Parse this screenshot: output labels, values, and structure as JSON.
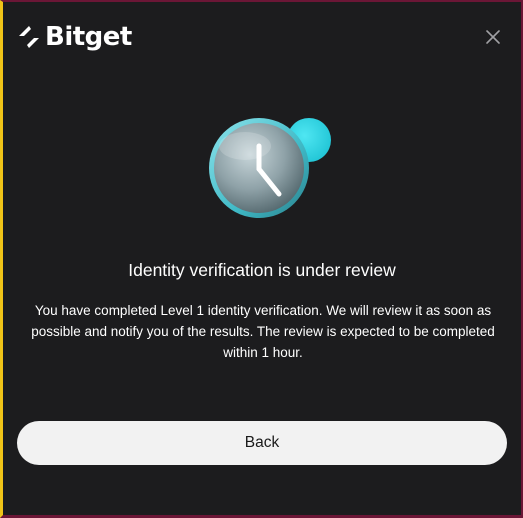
{
  "brand": {
    "name": "Bitget",
    "logo_icon": "bitget-logo-icon",
    "accent_color": "#2fd4e3"
  },
  "header": {
    "close_icon": "close-icon"
  },
  "status": {
    "icon": "clock-icon",
    "title": "Identity verification is under review",
    "description": "You have completed Level 1 identity verification. We will review it as soon as possible and notify you of the results. The review is expected to be completed within 1 hour."
  },
  "actions": {
    "back_label": "Back"
  }
}
